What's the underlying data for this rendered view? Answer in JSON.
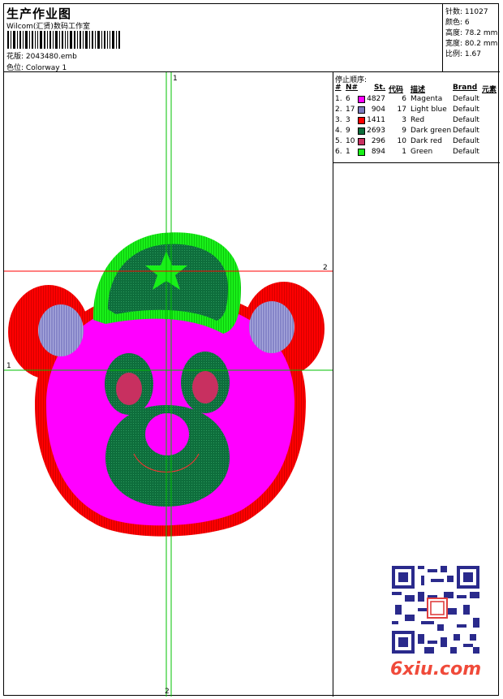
{
  "header": {
    "title": "生产作业图",
    "studio": "Wilcom(汇贤)数码工作室",
    "filename_label": "花版:",
    "filename": "2043480.emb",
    "colorway_label": "色位:",
    "colorway": "Colorway 1"
  },
  "stats": [
    {
      "label": "针数:",
      "value": "11027"
    },
    {
      "label": "颜色:",
      "value": "6"
    },
    {
      "label": "高度:",
      "value": "78.2 mm"
    },
    {
      "label": "宽度:",
      "value": "80.2 mm"
    },
    {
      "label": "比例:",
      "value": "1.67"
    }
  ],
  "color_table": {
    "title": "停止顺序:",
    "headers": [
      "#",
      "N#",
      "St.",
      "代码",
      "描述",
      "Brand",
      "元素"
    ],
    "rows": [
      {
        "idx": "1.",
        "n": "6",
        "st": "4827",
        "code": "6",
        "desc": "Magenta",
        "brand": "Default",
        "color": "#ff00ff"
      },
      {
        "idx": "2.",
        "n": "17",
        "st": "904",
        "code": "17",
        "desc": "Light blue",
        "brand": "Default",
        "color": "#7b7bbd"
      },
      {
        "idx": "3.",
        "n": "3",
        "st": "1411",
        "code": "3",
        "desc": "Red",
        "brand": "Default",
        "color": "#ff0000"
      },
      {
        "idx": "4.",
        "n": "9",
        "st": "2693",
        "code": "9",
        "desc": "Dark green",
        "brand": "Default",
        "color": "#0e6e3c"
      },
      {
        "idx": "5.",
        "n": "10",
        "st": "296",
        "code": "10",
        "desc": "Dark red",
        "brand": "Default",
        "color": "#c83060"
      },
      {
        "idx": "6.",
        "n": "1",
        "st": "894",
        "code": "1",
        "desc": "Green",
        "brand": "Default",
        "color": "#19f019"
      }
    ]
  },
  "guides": {
    "v_top": "1",
    "v_bottom": "2",
    "h_left": "1",
    "h_right": "2"
  },
  "watermark": "6xiu.com"
}
